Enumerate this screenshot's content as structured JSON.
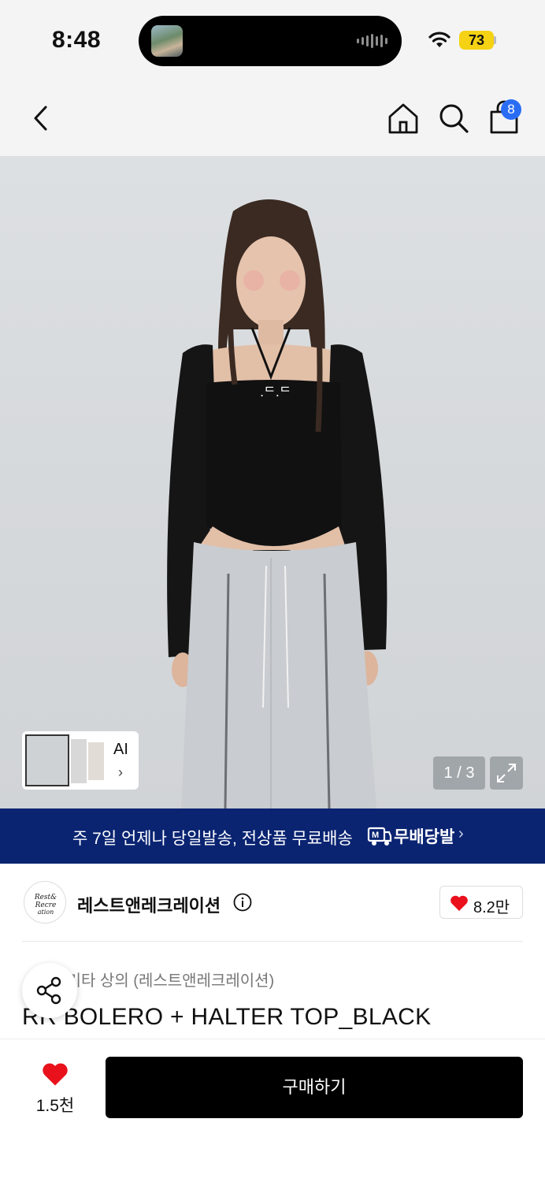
{
  "status_bar": {
    "time": "8:48",
    "battery": "73"
  },
  "navbar": {
    "cart_count": "8"
  },
  "hero": {
    "page_current": "1",
    "page_total": "3",
    "page_counter": "1 / 3",
    "ai_label": "AI",
    "ai_chevron": "›"
  },
  "banner": {
    "text": "주 7일 언제나 당일발송, 전상품 무료배송",
    "brand": "무배당발",
    "chevron": "›",
    "color": "#0a2472"
  },
  "brand": {
    "name": "레스트앤레크레이션",
    "logo_text": "Rest & Recreation",
    "like_count": "8.2만"
  },
  "product": {
    "category": "상의 · 기타 상의 (레스트앤레크레이션)",
    "title": "RR BOLERO + HALTER TOP_BLACK"
  },
  "bottom_bar": {
    "like_count": "1.5천",
    "buy_label": "구매하기"
  },
  "colors": {
    "accent_heart": "#e8111c",
    "badge_blue": "#2a6df5",
    "battery": "#f5d214"
  },
  "icons": [
    "back-icon",
    "home-icon",
    "search-icon",
    "cart-icon",
    "expand-icon",
    "info-icon",
    "heart-icon",
    "share-icon",
    "wifi-icon",
    "delivery-truck-icon"
  ]
}
